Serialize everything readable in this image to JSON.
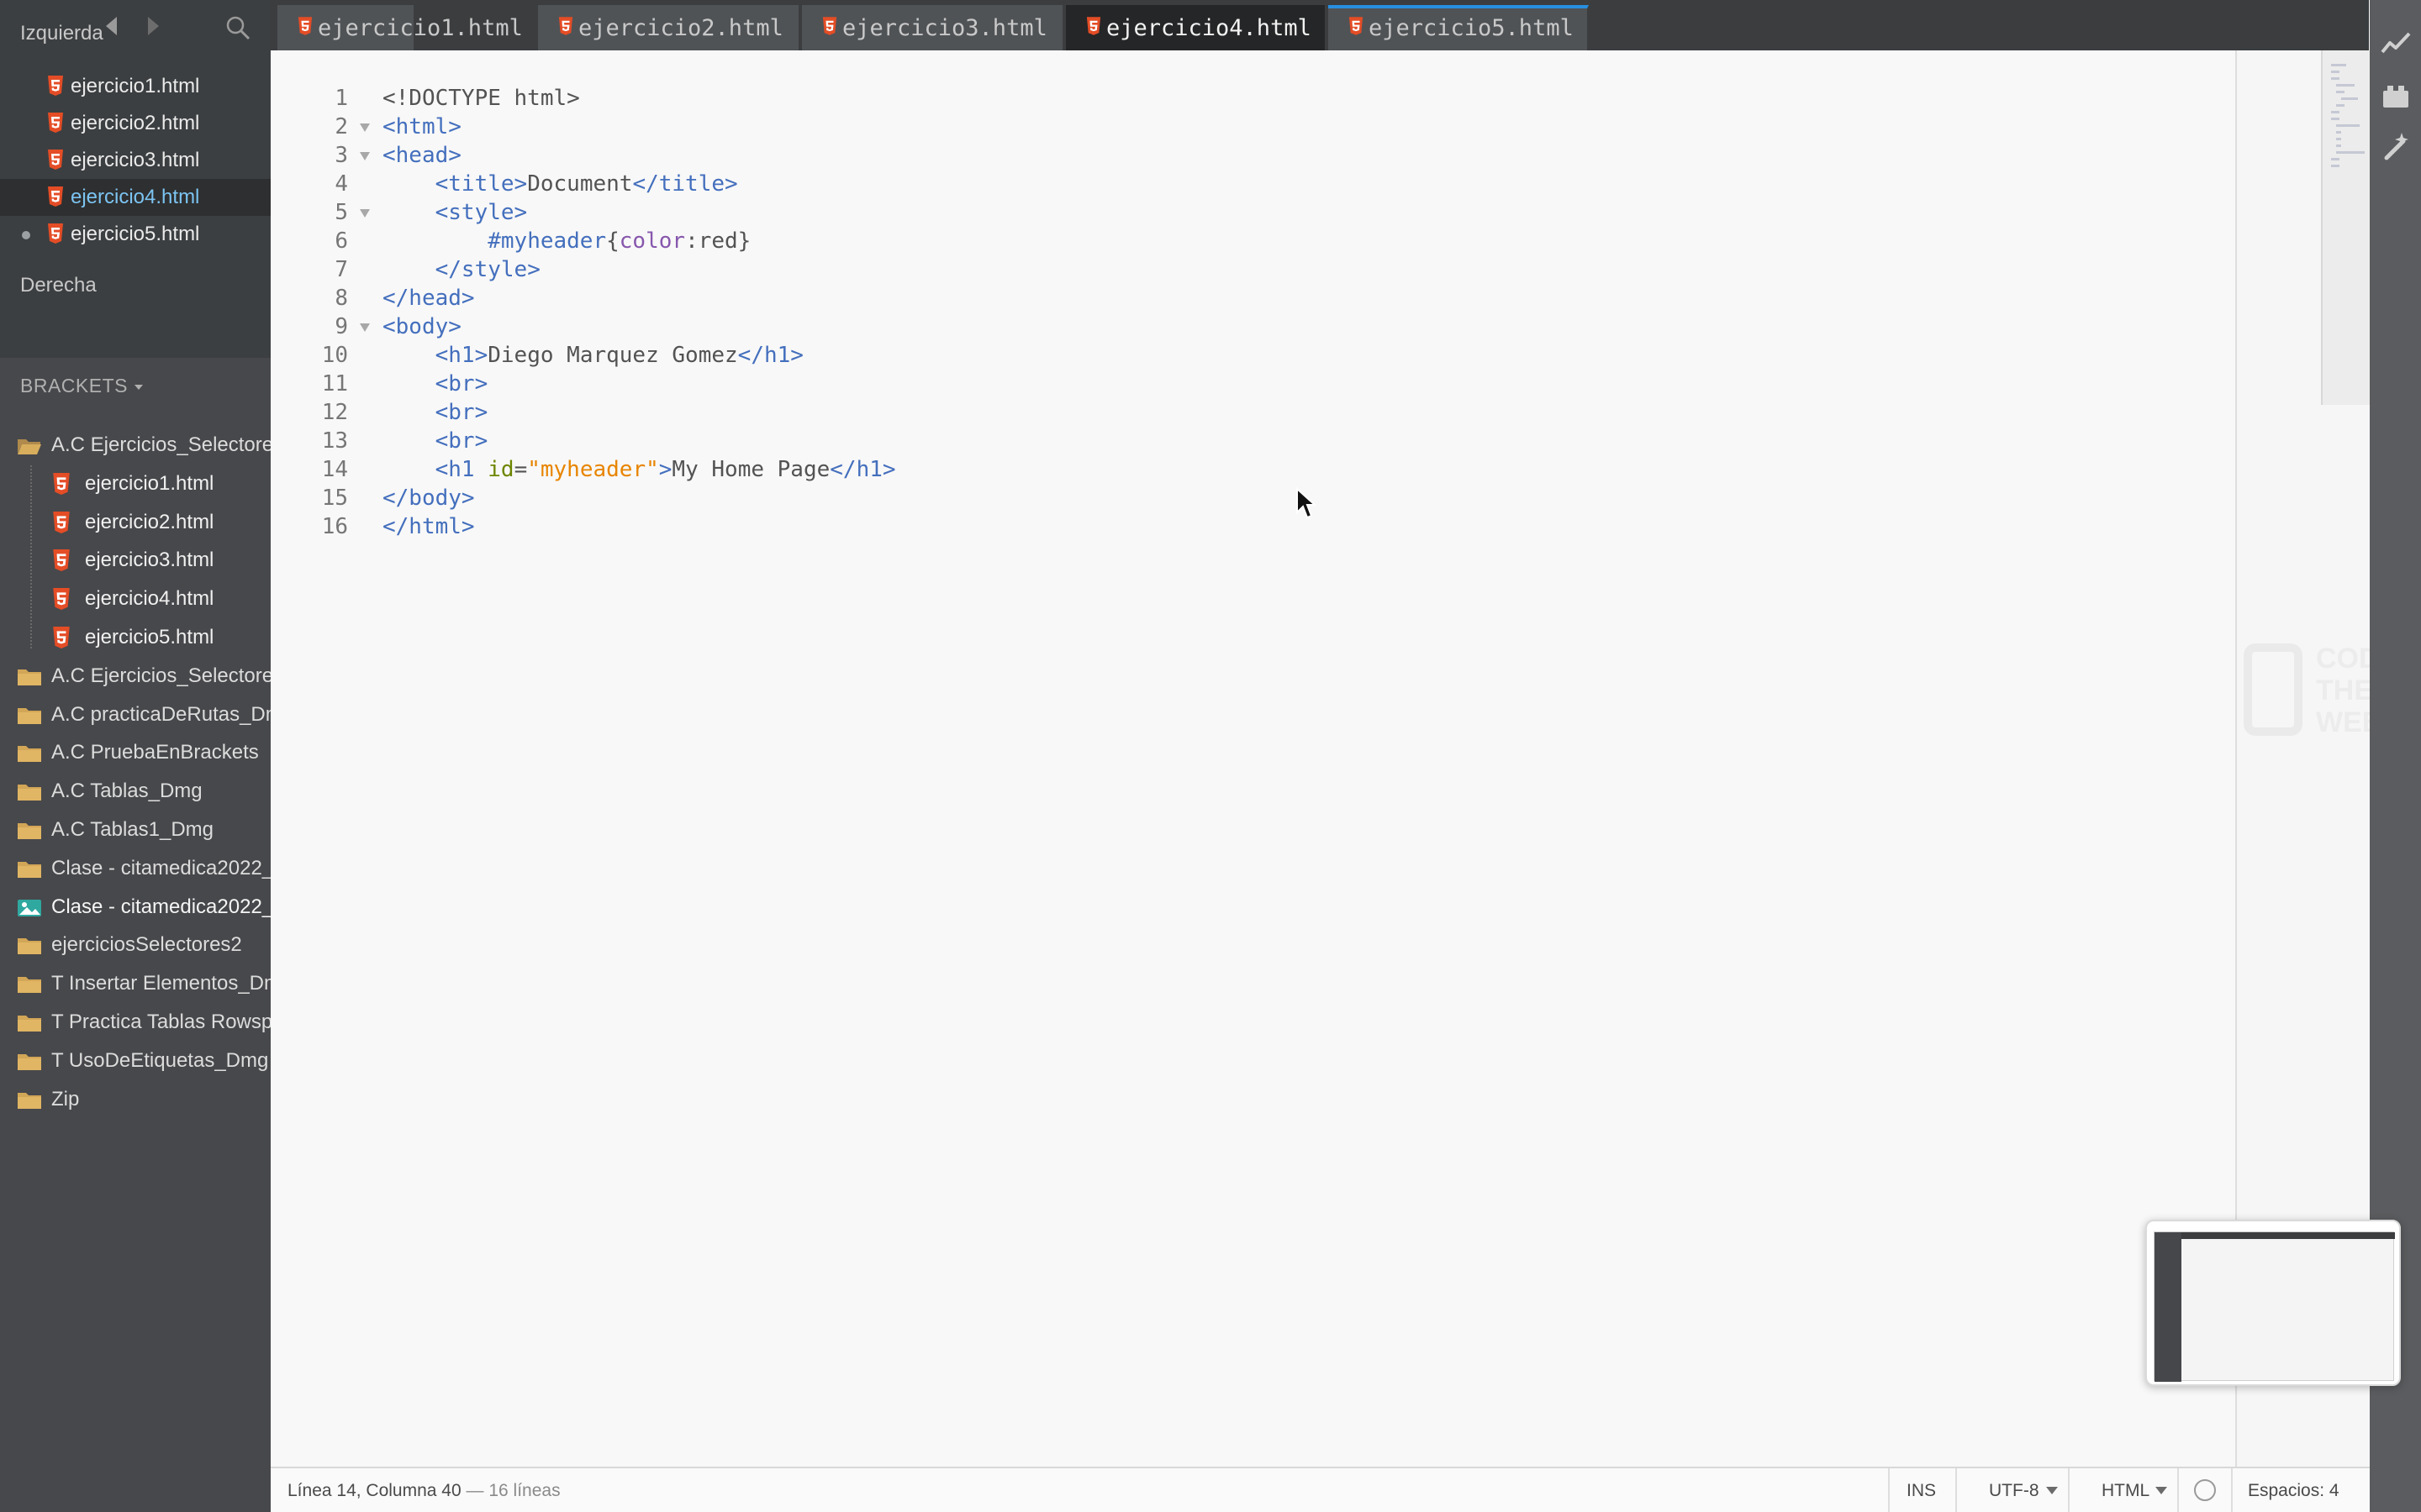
{
  "sidebar": {
    "left_pane_label": "Izquierda",
    "right_pane_label": "Derecha",
    "working_files": [
      {
        "name": "ejercicio1.html"
      },
      {
        "name": "ejercicio2.html"
      },
      {
        "name": "ejercicio3.html"
      },
      {
        "name": "ejercicio4.html"
      },
      {
        "name": "ejercicio5.html"
      }
    ],
    "project_title": "BRACKETS",
    "tree": [
      {
        "label": "A.C Ejercicios_Selectores",
        "kind": "folder-open"
      },
      {
        "label": "ejercicio1.html",
        "kind": "html"
      },
      {
        "label": "ejercicio2.html",
        "kind": "html"
      },
      {
        "label": "ejercicio3.html",
        "kind": "html"
      },
      {
        "label": "ejercicio4.html",
        "kind": "html"
      },
      {
        "label": "ejercicio5.html",
        "kind": "html"
      },
      {
        "label": "A.C Ejercicios_Selectores",
        "kind": "folder"
      },
      {
        "label": "A.C practicaDeRutas_Dmg",
        "kind": "folder"
      },
      {
        "label": "A.C PruebaEnBrackets",
        "kind": "folder"
      },
      {
        "label": "A.C Tablas_Dmg",
        "kind": "folder"
      },
      {
        "label": "A.C Tablas1_Dmg",
        "kind": "folder"
      },
      {
        "label": "Clase - citamedica2022_",
        "kind": "folder"
      },
      {
        "label": "Clase - citamedica2022_",
        "kind": "image"
      },
      {
        "label": "ejerciciosSelectores2",
        "kind": "folder"
      },
      {
        "label": "T Insertar Elementos_Dmg",
        "kind": "folder"
      },
      {
        "label": "T Practica Tablas Rowspan",
        "kind": "folder"
      },
      {
        "label": "T UsoDeEtiquetas_Dmg",
        "kind": "folder"
      },
      {
        "label": "Zip",
        "kind": "folder"
      }
    ]
  },
  "tabs": [
    {
      "label": "ejercicio1.html"
    },
    {
      "label": "ejercicio2.html"
    },
    {
      "label": "ejercicio3.html"
    },
    {
      "label": "ejercicio4.html",
      "active": true
    },
    {
      "label": "ejercicio5.html"
    }
  ],
  "editor": {
    "lines": [
      {
        "n": "1",
        "text": "<!DOCTYPE html>"
      },
      {
        "n": "2",
        "text": "<html>"
      },
      {
        "n": "3",
        "text": "<head>"
      },
      {
        "n": "4",
        "text": "    <title>Document</title>"
      },
      {
        "n": "5",
        "text": "    <style>"
      },
      {
        "n": "6",
        "text": "        #myheader{color:red}"
      },
      {
        "n": "7",
        "text": "    </style>"
      },
      {
        "n": "8",
        "text": "</head>"
      },
      {
        "n": "9",
        "text": "<body>"
      },
      {
        "n": "10",
        "text": "    <h1>Diego Marquez Gomez</h1>"
      },
      {
        "n": "11",
        "text": "    <br>"
      },
      {
        "n": "12",
        "text": "    <br>"
      },
      {
        "n": "13",
        "text": "    <br>"
      },
      {
        "n": "14",
        "text": "    <h1 id=\"myheader\">My Home Page</h1>"
      },
      {
        "n": "15",
        "text": "</body>"
      },
      {
        "n": "16",
        "text": "</html>"
      }
    ]
  },
  "watermark": {
    "line1": "CODE",
    "line2": "THE",
    "line3": "WEB"
  },
  "statusbar": {
    "position": "Línea 14, Columna 40",
    "line_count": "— 16 líneas",
    "mode": "INS",
    "encoding": "UTF-8",
    "language": "HTML",
    "indent": "Espacios: 4"
  },
  "colors": {
    "sidebar_bg": "#47484b",
    "active_tab_bg": "#252627",
    "tag": "#446fbd",
    "attribute": "#6d8600",
    "string": "#e88501",
    "property": "#8757ad",
    "selected_file": "#7cc4f2"
  }
}
